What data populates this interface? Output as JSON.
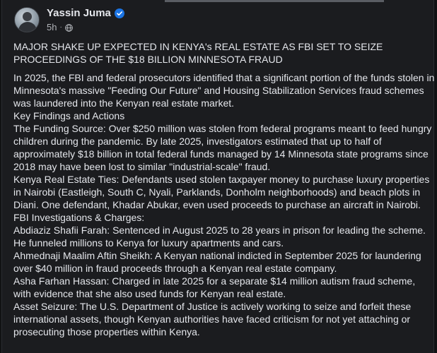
{
  "post": {
    "author": "Yassin Juma",
    "time": "5h",
    "dot": "·",
    "headline": "MAJOR SHAKE UP EXPECTED IN KENYA's REAL ESTATE AS FBI SET TO SEIZE PROCEEDINGS OF THE $18 BILLION MINNESOTA FRAUD",
    "paragraphs": [
      "In 2025, the FBI and federal prosecutors identified that a significant portion of the funds stolen in Minnesota's massive \"Feeding Our Future\" and Housing Stabilization Services fraud schemes was laundered into the Kenyan real estate market.",
      "Key Findings and Actions",
      "The Funding Source: Over $250 million was stolen from federal programs meant to feed hungry children during the pandemic. By late 2025, investigators estimated that up to half of approximately $18 billion in total federal funds managed by 14 Minnesota state programs since 2018 may have been lost to similar \"industrial-scale\" fraud.",
      "Kenya Real Estate Ties: Defendants used stolen taxpayer money to purchase luxury properties in Nairobi (Eastleigh, South C, Nyali, Parklands, Donholm neighborhoods) and beach plots in Diani. One defendant, Khadar Abukar, even used proceeds to purchase an aircraft in Nairobi.",
      "FBI Investigations & Charges:",
      "Abdiaziz Shafii Farah: Sentenced in August 2025 to 28 years in prison for leading the scheme. He funneled millions to Kenya for luxury apartments and cars.",
      "Ahmednaji Maalim Aftin Sheikh: A Kenyan national indicted in September 2025 for laundering over $40 million in fraud proceeds through a Kenyan real estate company.",
      "Asha Farhan Hassan: Charged in late 2025 for a separate $14 million autism fraud scheme, with evidence that she also used funds for Kenyan real estate.",
      "Asset Seizure: The U.S. Department of Justice is actively working to seize and forfeit these international assets, though Kenyan authorities have faced criticism for not yet attaching or prosecuting those properties within Kenya."
    ]
  },
  "colors": {
    "background": "#1b1c1f",
    "text": "#e4e6eb",
    "secondary_text": "#b0b3b8",
    "verified": "#1b74e4"
  },
  "icons": {
    "verified": "verified-badge-icon",
    "audience": "globe-icon"
  }
}
